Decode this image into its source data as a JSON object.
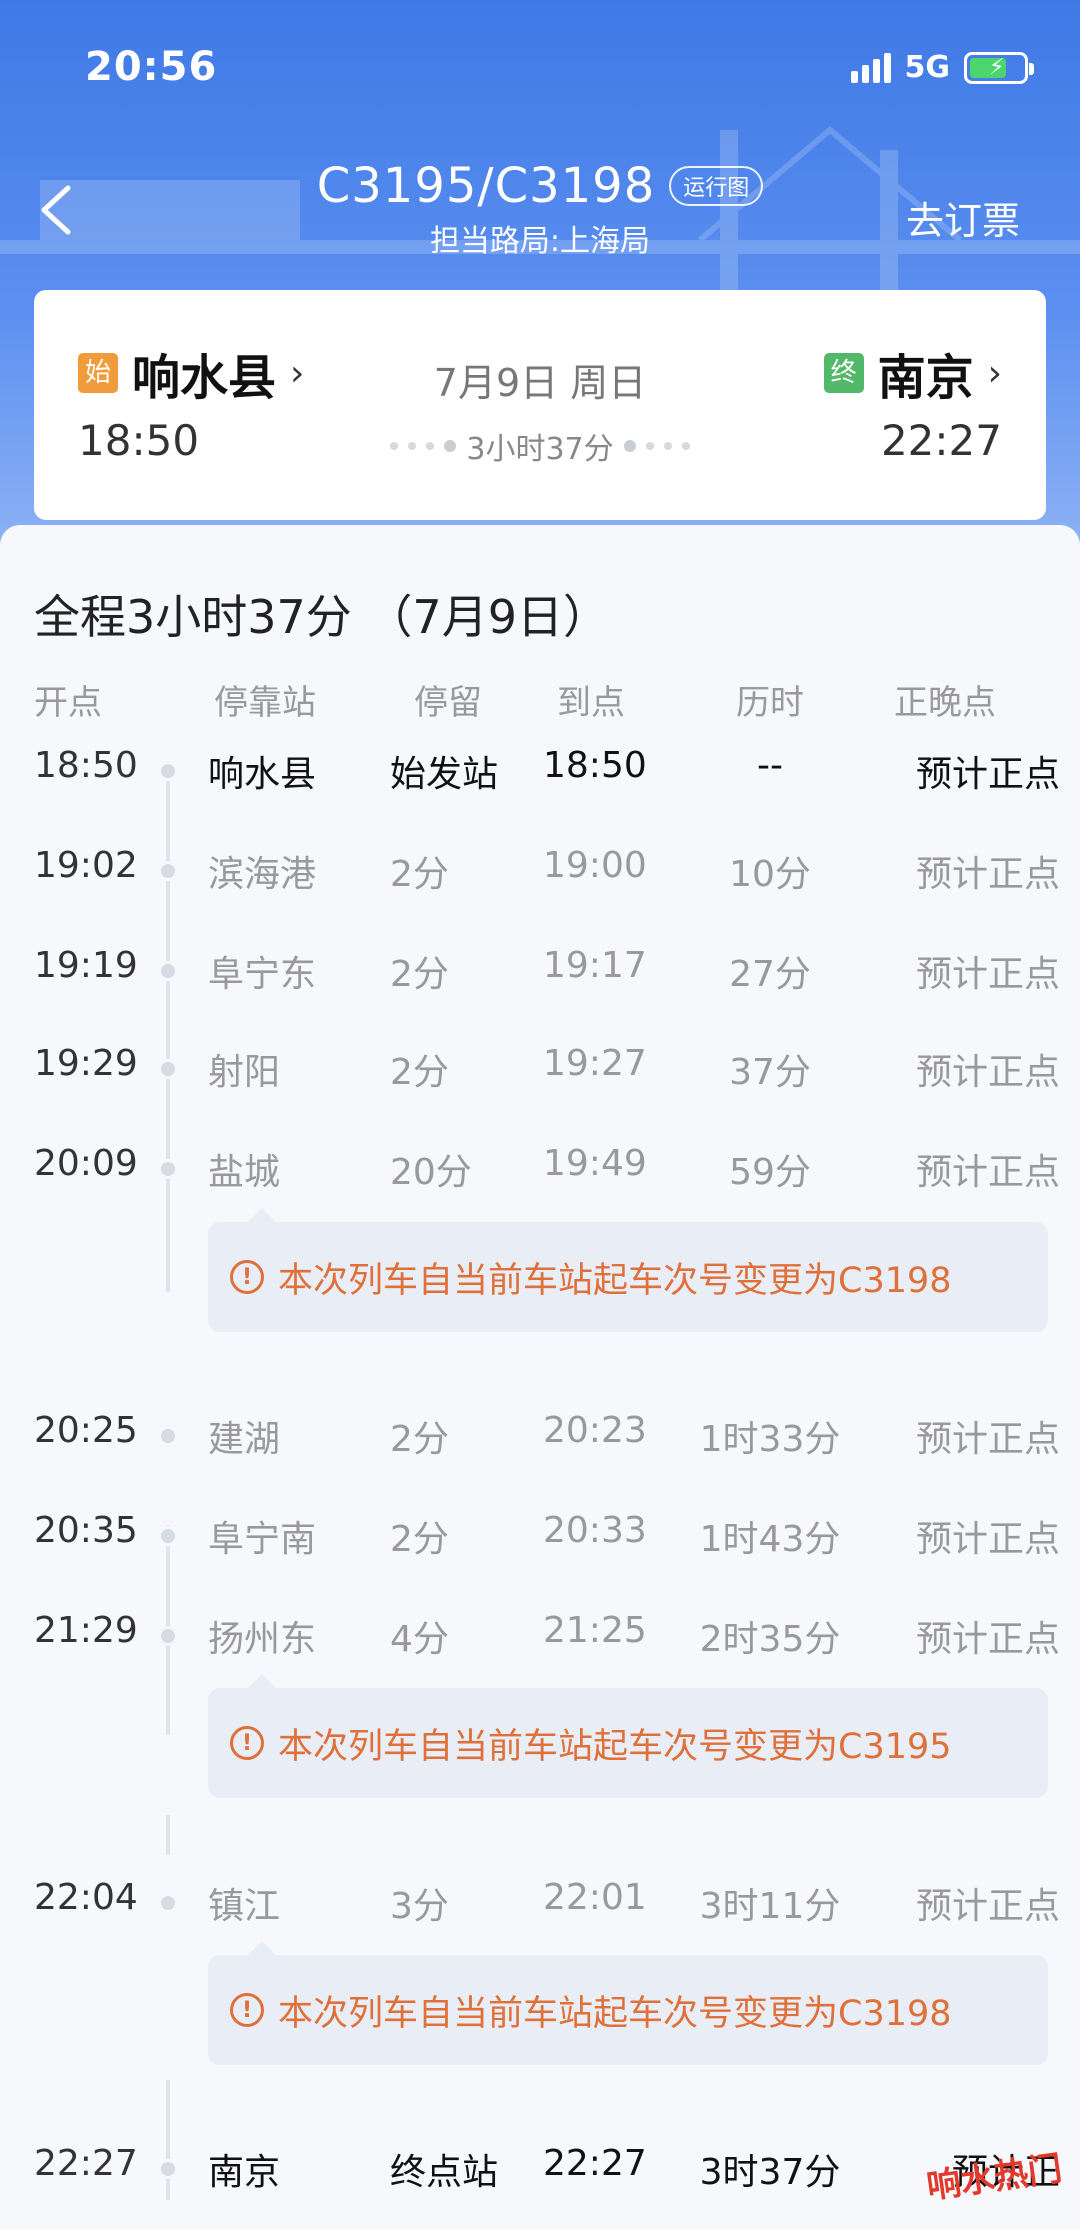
{
  "status_bar": {
    "time": "20:56",
    "network": "5G"
  },
  "nav": {
    "train_no": "C3195/C3198",
    "run_chart_label": "运行图",
    "bureau": "担当路局:上海局",
    "book_label": "去订票"
  },
  "journey": {
    "start_badge": "始",
    "end_badge": "终",
    "from_station": "响水县",
    "to_station": "南京",
    "date": "7月9日 周日",
    "depart_time": "18:50",
    "arrive_time": "22:27",
    "duration": "3小时37分"
  },
  "schedule": {
    "total_label": "全程3小时37分 （7月9日）",
    "headers": [
      "开点",
      "停靠站",
      "停留",
      "到点",
      "历时",
      "正晚点"
    ],
    "stops": [
      {
        "dep": "18:50",
        "station": "响水县",
        "stay": "始发站",
        "arr": "18:50",
        "elapsed": "--",
        "status": "预计正点"
      },
      {
        "dep": "19:02",
        "station": "滨海港",
        "stay": "2分",
        "arr": "19:00",
        "elapsed": "10分",
        "status": "预计正点"
      },
      {
        "dep": "19:19",
        "station": "阜宁东",
        "stay": "2分",
        "arr": "19:17",
        "elapsed": "27分",
        "status": "预计正点"
      },
      {
        "dep": "19:29",
        "station": "射阳",
        "stay": "2分",
        "arr": "19:27",
        "elapsed": "37分",
        "status": "预计正点"
      },
      {
        "dep": "20:09",
        "station": "盐城",
        "stay": "20分",
        "arr": "19:49",
        "elapsed": "59分",
        "status": "预计正点"
      },
      {
        "dep": "20:25",
        "station": "建湖",
        "stay": "2分",
        "arr": "20:23",
        "elapsed": "1时33分",
        "status": "预计正点"
      },
      {
        "dep": "20:35",
        "station": "阜宁南",
        "stay": "2分",
        "arr": "20:33",
        "elapsed": "1时43分",
        "status": "预计正点"
      },
      {
        "dep": "21:29",
        "station": "扬州东",
        "stay": "4分",
        "arr": "21:25",
        "elapsed": "2时35分",
        "status": "预计正点"
      },
      {
        "dep": "22:04",
        "station": "镇江",
        "stay": "3分",
        "arr": "22:01",
        "elapsed": "3时11分",
        "status": "预计正点"
      },
      {
        "dep": "22:27",
        "station": "南京",
        "stay": "终点站",
        "arr": "22:27",
        "elapsed": "3时37分",
        "status": "预计正"
      }
    ],
    "notices": [
      "本次列车自当前车站起车次号变更为C3198",
      "本次列车自当前车站起车次号变更为C3195",
      "本次列车自当前车站起车次号变更为C3198"
    ]
  },
  "watermark": "响水热门",
  "colors": {
    "hero": "#3f79e6",
    "notice_text": "#e0703a",
    "start_badge": "#f29b3c",
    "end_badge": "#52b96a"
  }
}
